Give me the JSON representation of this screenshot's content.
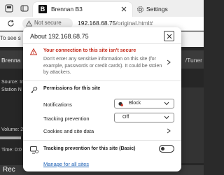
{
  "browser": {
    "active_tab": {
      "title": "Brennan B3",
      "favicon": "B"
    },
    "other_tab": {
      "title": "Settings"
    },
    "address": {
      "security_chip": "Not secure",
      "url_host": "192.168.68.75",
      "url_path": "/original.html#"
    }
  },
  "page_behind": {
    "top_text": "To see s",
    "header_left": "Brenna",
    "header_right": "/Tuner",
    "rows": [
      "Source: In",
      "Station N"
    ],
    "volume_label": "Volume: 2",
    "time_label": "Time: 0:0",
    "bottom_text": "Rec"
  },
  "popup": {
    "title": "About 192.168.68.75",
    "warning": {
      "title": "Your connection to this site isn't secure",
      "body": "Don't enter any sensitive information on this site (for example, passwords or credit cards). It could be stolen by attackers."
    },
    "permissions_title": "Permissions for this site",
    "rows": {
      "notifications": {
        "label": "Notifications",
        "value": "Block"
      },
      "tracking": {
        "label": "Tracking prevention",
        "value": "Off"
      },
      "cookies": {
        "label": "Cookies and site data"
      }
    },
    "tracking_basic_label": "Tracking prevention for this site (Basic)",
    "manage_link": "Manage for all sites"
  }
}
